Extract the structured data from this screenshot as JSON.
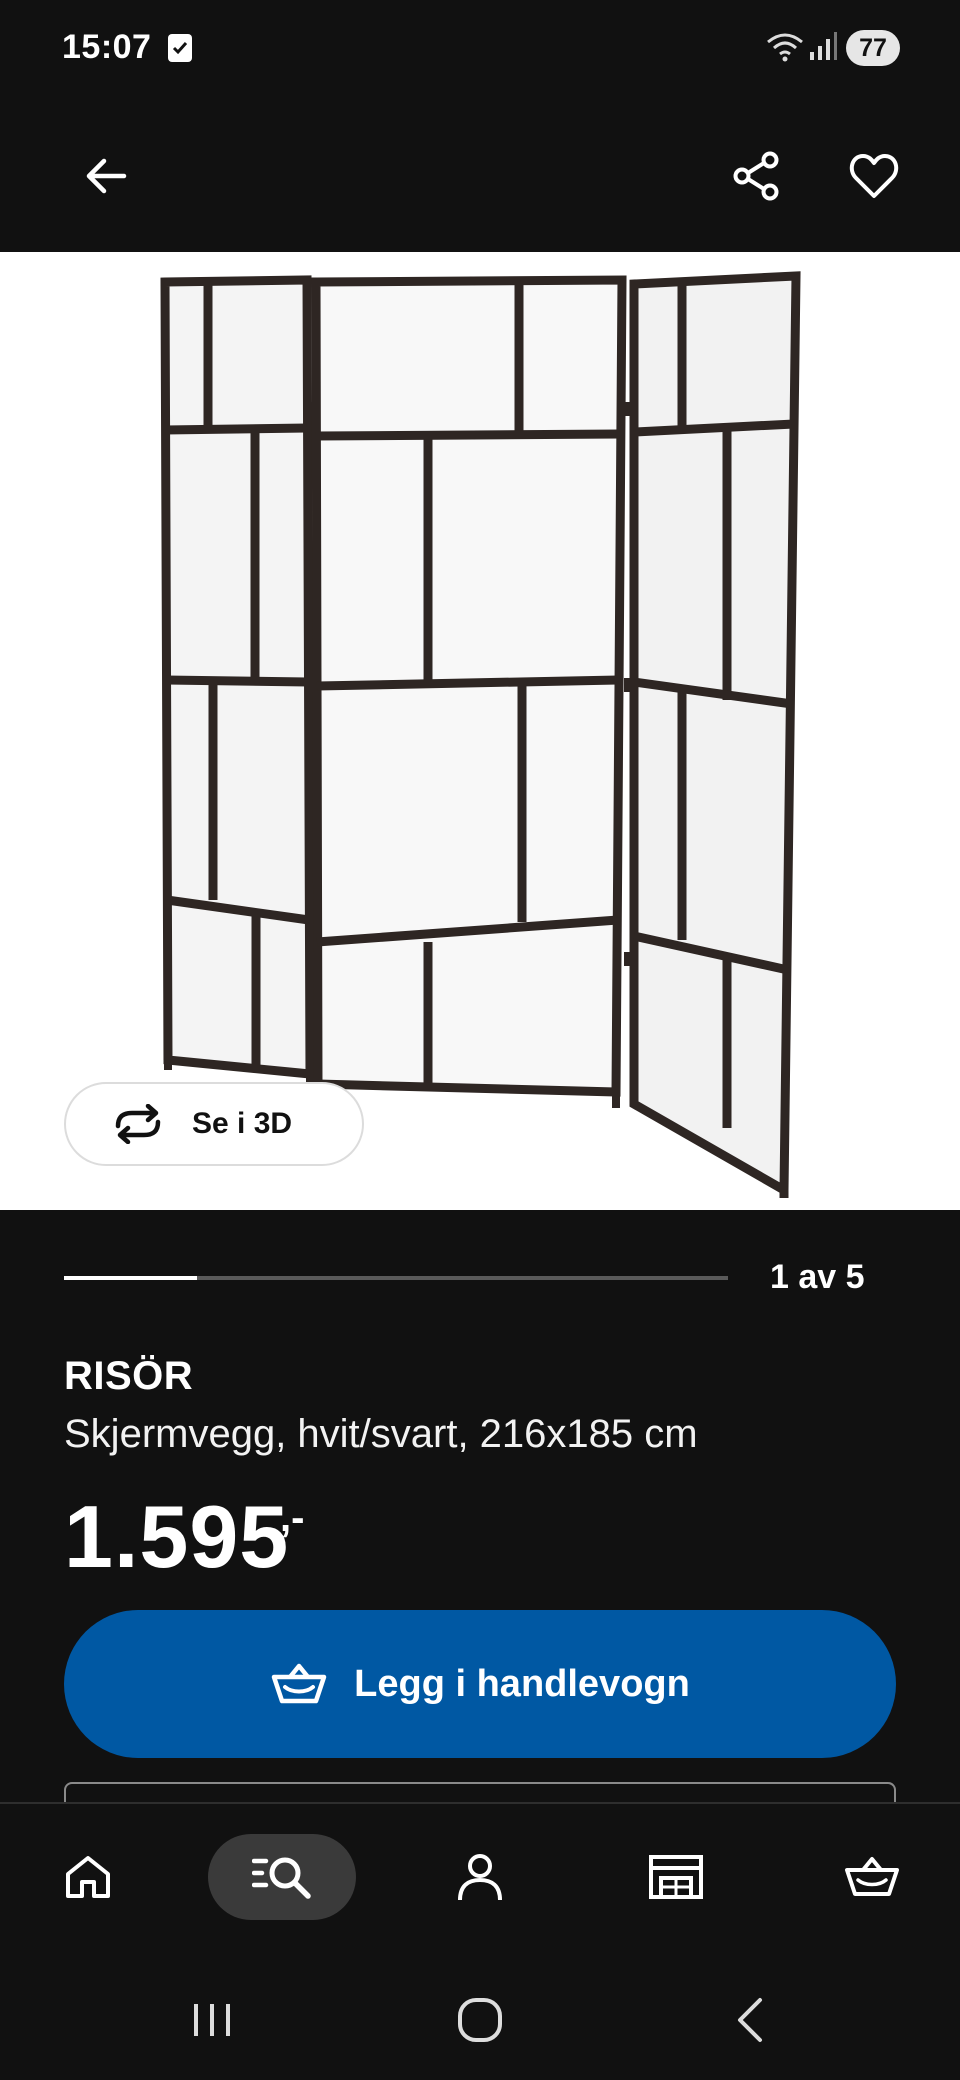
{
  "status_bar": {
    "time": "15:07",
    "battery": "77",
    "icons": [
      "checkbox-notification-icon",
      "wifi-icon",
      "signal-icon"
    ]
  },
  "app_bar": {
    "icons": [
      "back-arrow-icon",
      "share-icon",
      "heart-icon"
    ]
  },
  "gallery": {
    "see_3d_label": "Se i 3D",
    "current_index": 1,
    "total": 5,
    "page_label": "1 av 5",
    "progress_fraction": 0.2
  },
  "product": {
    "name": "RISÖR",
    "description": "Skjermvegg, hvit/svart, 216x185 cm",
    "price": "1.595",
    "price_suffix": ",-"
  },
  "actions": {
    "add_to_cart_label": "Legg i handlevogn"
  },
  "bottom_nav": {
    "items": [
      {
        "icon": "home-icon",
        "active": false
      },
      {
        "icon": "search-icon",
        "active": true
      },
      {
        "icon": "profile-icon",
        "active": false
      },
      {
        "icon": "store-icon",
        "active": false
      },
      {
        "icon": "cart-icon",
        "active": false
      }
    ]
  },
  "system_nav": {
    "icons": [
      "recents-icon",
      "home-circle-icon",
      "back-chevron-icon"
    ]
  },
  "colors": {
    "background": "#111111",
    "accent_blue": "#0058a3",
    "white": "#ffffff"
  }
}
